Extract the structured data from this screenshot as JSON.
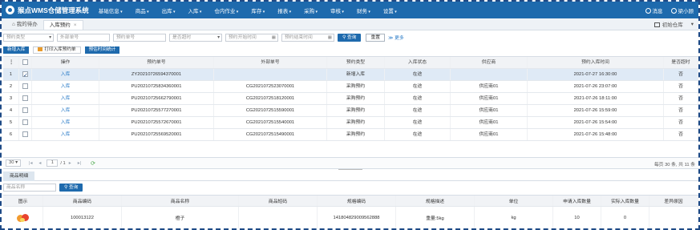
{
  "app": {
    "title": "猴点WMS仓储管理系统",
    "menu": [
      "基础信息",
      "商品",
      "出库",
      "入库",
      "仓内作业",
      "库存",
      "报表",
      "采购",
      "审核",
      "财务",
      "设置"
    ],
    "message_label": "消息",
    "user_label": "梁小顾"
  },
  "tabs": {
    "home_label": "我的待办",
    "active_label": "入库预约",
    "close_glyph": "×",
    "warehouse_label": "初始仓库",
    "extra": "▾"
  },
  "filters": {
    "type_placeholder": "预约类型",
    "external_no_placeholder": "外部单号",
    "appoint_no_placeholder": "预约单号",
    "timeout_placeholder": "是否超时",
    "start_placeholder": "预约开始时间",
    "end_placeholder": "预约结束时间",
    "search_label": "查询",
    "reset_label": "重置",
    "more_label": "更多"
  },
  "actions": {
    "new_inbound": "新增入库",
    "print_inbound": "打印入库预约单",
    "stat_label": "预估时间统计"
  },
  "grid": {
    "headers": [
      "",
      "",
      "操作",
      "预约单号",
      "外部单号",
      "预约类型",
      "入库状态",
      "供应商",
      "预约入库时间",
      "是否超时"
    ],
    "rows": [
      {
        "idx": "1",
        "op": "入库",
        "no": "ZY20210726594370001",
        "ext": "",
        "type": "新增入库",
        "status": "在途",
        "supplier": "",
        "time": "2021-07-27 16:30:00",
        "timeout": "否",
        "checked": true
      },
      {
        "idx": "2",
        "op": "入库",
        "no": "PU20210725834360001",
        "ext": "CG2021072523070001",
        "type": "采购预约",
        "status": "在途",
        "supplier": "供应商01",
        "time": "2021-07-26 23:07:00",
        "timeout": "否",
        "checked": false
      },
      {
        "idx": "3",
        "op": "入库",
        "no": "PU20210725662790001",
        "ext": "CG2021072518120001",
        "type": "采购预约",
        "status": "在途",
        "supplier": "供应商01",
        "time": "2021-07-26 18:11:00",
        "timeout": "否",
        "checked": false
      },
      {
        "idx": "4",
        "op": "入库",
        "no": "PU20210725577270001",
        "ext": "CG2021072515590001",
        "type": "采购预约",
        "status": "在途",
        "supplier": "供应商01",
        "time": "2021-07-26 15:59:00",
        "timeout": "否",
        "checked": false
      },
      {
        "idx": "5",
        "op": "入库",
        "no": "PU20210725572670001",
        "ext": "CG2021072515540001",
        "type": "采购预约",
        "status": "在途",
        "supplier": "供应商01",
        "time": "2021-07-26 15:54:00",
        "timeout": "否",
        "checked": false
      },
      {
        "idx": "6",
        "op": "入库",
        "no": "PU20210725569520001",
        "ext": "CG2021072515490001",
        "type": "采购预约",
        "status": "在途",
        "supplier": "供应商01",
        "time": "2021-07-26 15:48:00",
        "timeout": "否",
        "checked": false
      }
    ]
  },
  "pager": {
    "page_size": "30",
    "page_current": "1",
    "page_total": "/ 1",
    "total_text": "每页 30 条, 共 11 条"
  },
  "detail": {
    "tab_label": "商品明细",
    "search_placeholder": "商品名称",
    "search_label": "查询",
    "headers": [
      "图示",
      "商品编码",
      "商品名称",
      "商品短码",
      "规格编码",
      "规格描述",
      "单位",
      "申请入库数量",
      "实际入库数量",
      "差异原因"
    ],
    "row": {
      "image": "orange-image",
      "code": "100013122",
      "name": "橙子",
      "short_code": "",
      "spec_code": "141804829009562888",
      "spec_desc": "重量:5kg",
      "unit": "kg",
      "apply_qty": "10",
      "actual_qty": "0",
      "reason": ""
    }
  },
  "colors": {
    "brand": "#1e6aad",
    "link": "#2b7cc8",
    "selected_row": "#dfeaf6",
    "frame": "#1e4a86"
  }
}
